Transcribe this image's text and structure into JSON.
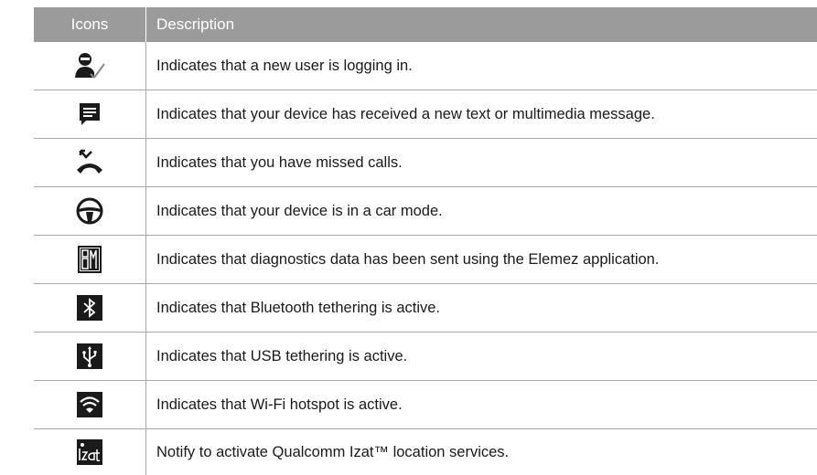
{
  "header": {
    "icons": "Icons",
    "description": "Description"
  },
  "rows": [
    {
      "icon": "user-login-icon",
      "text": "Indicates that a new user is logging in."
    },
    {
      "icon": "message-icon",
      "text": "Indicates that your device has received a new text or multimedia message."
    },
    {
      "icon": "missed-call-icon",
      "text": "Indicates that you have missed calls."
    },
    {
      "icon": "car-mode-icon",
      "text": "Indicates that your device is in a car mode."
    },
    {
      "icon": "elemez-diagnostics-icon",
      "text": "Indicates that diagnostics data has been sent using the Elemez application."
    },
    {
      "icon": "bluetooth-tethering-icon",
      "text": "Indicates that Bluetooth tethering is active."
    },
    {
      "icon": "usb-tethering-icon",
      "text": "Indicates that USB tethering is active."
    },
    {
      "icon": "wifi-hotspot-icon",
      "text": "Indicates that Wi-Fi hotspot is active."
    },
    {
      "icon": "izat-location-icon",
      "text": "Notify to activate Qualcomm Izat™ location services."
    }
  ],
  "colors": {
    "header_bg": "#9b9b9b",
    "icon_dark": "#1a1a1a",
    "rule": "#a8a8a8"
  }
}
